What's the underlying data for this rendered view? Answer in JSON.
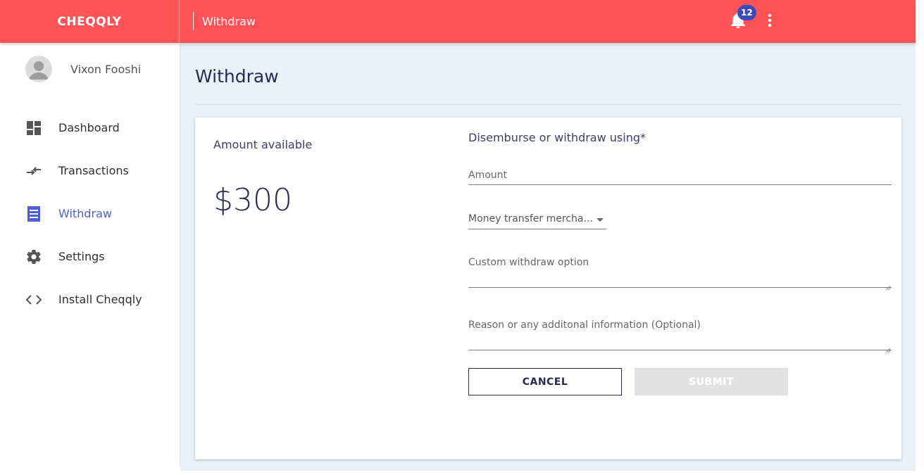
{
  "app": {
    "brand": "CHEQQLY",
    "header_title": "Withdraw",
    "notifications_count": "12",
    "colors": {
      "topbar": "#ff5457",
      "accent": "#4b5fd6",
      "badge": "#3b4cb8",
      "navy": "#262b55",
      "main_bg": "#e9f0f8"
    }
  },
  "header": {
    "icons": [
      "bell-icon",
      "more-vert-icon"
    ]
  },
  "sidebar": {
    "user": {
      "name": "Vixon Fooshi",
      "avatar": "person-icon"
    },
    "items": [
      {
        "label": "Dashboard",
        "icon": "dashboard-icon",
        "active": false
      },
      {
        "label": "Transactions",
        "icon": "swap-arrows-icon",
        "active": false
      },
      {
        "label": "Withdraw",
        "icon": "receipt-icon",
        "active": true
      },
      {
        "label": "Settings",
        "icon": "gear-icon",
        "active": false
      },
      {
        "label": "Install Cheqqly",
        "icon": "code-icon",
        "active": false
      }
    ]
  },
  "main": {
    "title": "Withdraw",
    "available": {
      "label": "Amount available",
      "amount": "$300"
    },
    "form": {
      "title": "Disemburse or withdraw using*",
      "amount_placeholder": "Amount",
      "method_selected": "Money transfer mercha...",
      "custom_placeholder": "Custom withdraw option",
      "reason_placeholder": "Reason or any additonal information (Optional)",
      "cancel_label": "CANCEL",
      "submit_label": "SUBMIT"
    }
  }
}
